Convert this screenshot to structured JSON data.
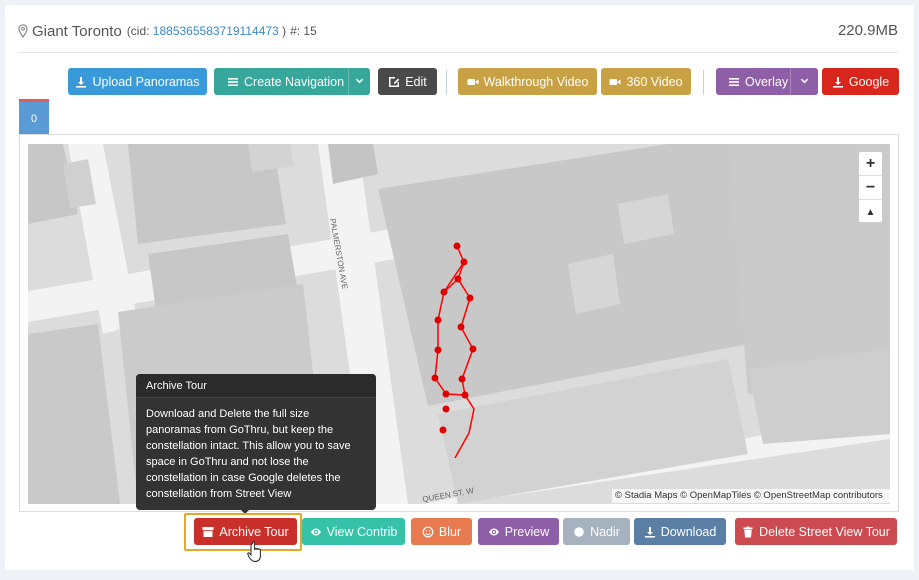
{
  "header": {
    "title": "Giant Toronto",
    "cid_prefix": "(cid:",
    "cid_value": "1885365583719114473",
    "cid_suffix": ")",
    "count": "#: 15",
    "size": "220.9MB"
  },
  "toolbar": {
    "upload": "Upload Panoramas",
    "create_nav": "Create Navigation",
    "edit": "Edit",
    "walkthrough": "Walkthrough Video",
    "video360": "360 Video",
    "overlay": "Overlay",
    "google": "Google"
  },
  "tabs": [
    "0"
  ],
  "map": {
    "street_label_1": "PALMERSTON AVE",
    "street_label_2": "QUEEN ST. W",
    "attribution": "© Stadia Maps © OpenMapTiles © OpenStreetMap contributors",
    "zoom_in": "+",
    "zoom_out": "−",
    "reset": "▲"
  },
  "tooltip": {
    "title": "Archive Tour",
    "body": "Download and Delete the full size panoramas from GoThru, but keep the constellation intact. This allow you to save space in GoThru and not lose the constellation in case Google deletes the constellation from Street View"
  },
  "actions": {
    "archive": "Archive Tour",
    "view_contrib": "View Contrib",
    "blur": "Blur",
    "preview": "Preview",
    "nadir": "Nadir",
    "download": "Download",
    "delete_sv": "Delete Street View Tour"
  },
  "colors": {
    "blue": "#3a9ad9",
    "teal": "#36a79a",
    "dark": "#4a4a4a",
    "gold": "#c7a143",
    "purple": "#8e5ea6",
    "red": "#d9261c",
    "archive_red": "#c9302c",
    "orange": "#e87a4f",
    "gray": "#a7b2c1",
    "steel": "#5b7ea4",
    "delete_red": "#cc4b50",
    "teal_contrib": "#36c2a8"
  }
}
